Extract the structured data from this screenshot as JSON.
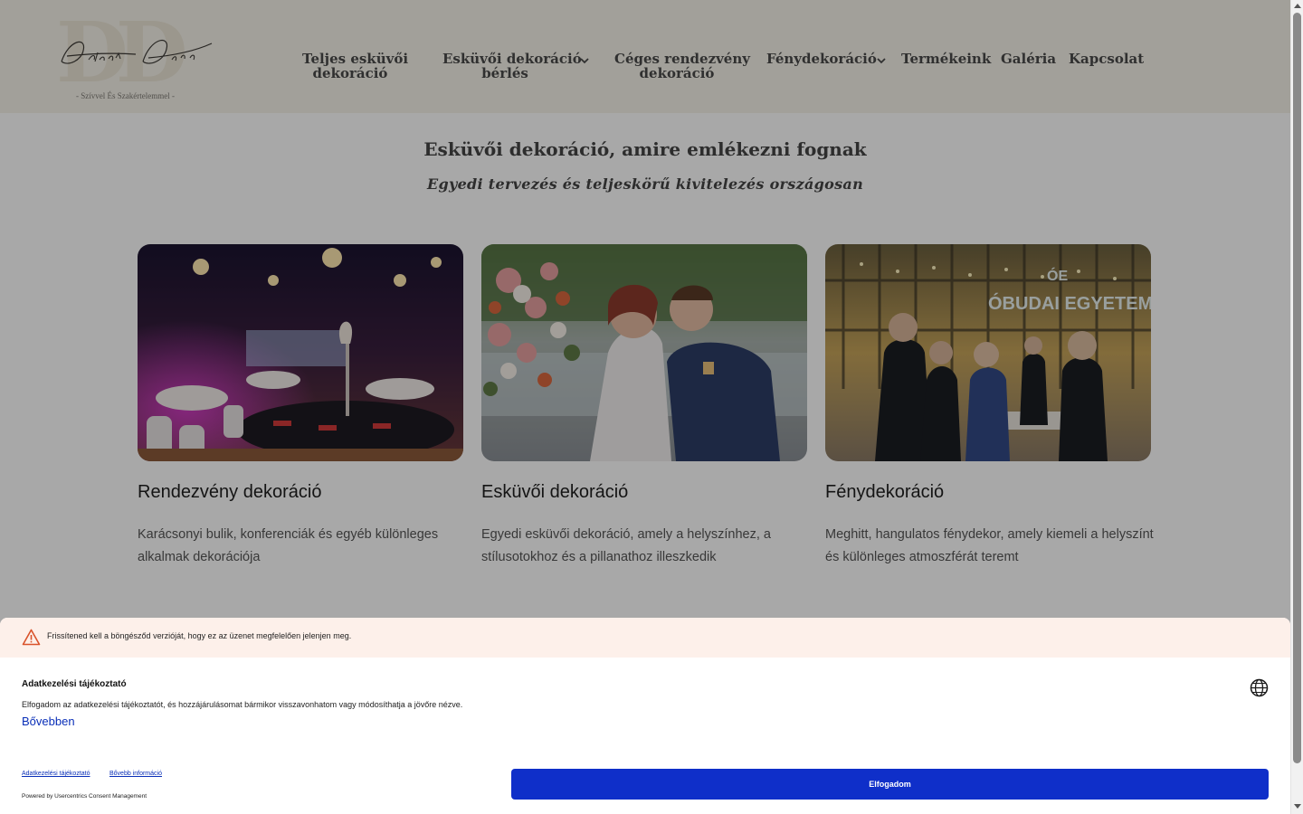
{
  "header": {
    "logo": {
      "monogram": "DD",
      "script_text": "Dekor Duó",
      "tagline": "- Szívvel És Szakértelemmel -"
    },
    "nav": [
      {
        "label_line1": "Teljes esküvői",
        "label_line2": "dekoráció",
        "has_dropdown": false
      },
      {
        "label_line1": "Esküvői dekoráció",
        "label_line2": "bérlés",
        "has_dropdown": true
      },
      {
        "label_line1": "Céges rendezvény",
        "label_line2": "dekoráció",
        "has_dropdown": false
      },
      {
        "label_line1": "Fénydekoráció",
        "label_line2": "",
        "has_dropdown": true
      },
      {
        "label_line1": "Termékeink",
        "label_line2": "",
        "has_dropdown": false
      },
      {
        "label_line1": "Galéria",
        "label_line2": "",
        "has_dropdown": false
      },
      {
        "label_line1": "Kapcsolat",
        "label_line2": "",
        "has_dropdown": false
      }
    ]
  },
  "hero": {
    "title": "Esküvői dekoráció, amire emlékezni fognak",
    "subtitle": "Egyedi tervezés és teljeskörű kivitelezés országosan"
  },
  "cards": [
    {
      "title": "Rendezvény dekoráció",
      "text": "Karácsonyi bulik, konferenciák és egyéb különleges alkalmak dekorációja",
      "image": "event-hall-photo"
    },
    {
      "title": "Esküvői dekoráció",
      "text": "Egyedi esküvői dekoráció, amely a helyszínhez, a stílusotokhoz és a pillanathoz illeszkedik",
      "image": "wedding-couple-photo"
    },
    {
      "title": "Fénydekoráció",
      "text": "Meghitt, hangulatos fénydekor, amely kiemeli a helyszínt és különleges atmoszférát teremt",
      "image": "light-decor-event-photo",
      "sign_text": "ÓBUDAI EGYETEM",
      "sign_logo": "ÓE"
    }
  ],
  "consent": {
    "warning": "Frissítened kell a böngésződ verzióját, hogy ez az üzenet megfelelően jelenjen meg.",
    "title": "Adatkezelési tájékoztató",
    "body": "Elfogadom az adatkezelési tájékoztatót, és hozzájárulásomat bármikor visszavonhatom vagy módosíthatja a jövőre nézve.",
    "more_link": "Bővebben",
    "links": [
      "Adatkezelési tájékoztató",
      "Bővebb információ"
    ],
    "powered_by": "Powered by Usercentrics Consent Management",
    "accept_label": "Elfogadom"
  },
  "colors": {
    "accent": "#0f2fc9",
    "header_bg": "#f6f3ea",
    "warning_bg": "#fdf0ea"
  }
}
